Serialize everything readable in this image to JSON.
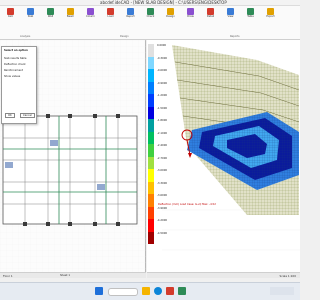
{
  "window": {
    "title": "abcdef.ideCAD - [NEW SLAB DESIGN] - C:\\USERS\\ENG\\DESKTOP"
  },
  "ribbon": {
    "buttons": [
      {
        "label": "Calc"
      },
      {
        "label": "Slab"
      },
      {
        "label": "Wall"
      },
      {
        "label": "Beam"
      },
      {
        "label": "Column"
      },
      {
        "label": "Load"
      },
      {
        "label": "Report"
      },
      {
        "label": "Check"
      },
      {
        "label": "Design"
      },
      {
        "label": "Draw"
      },
      {
        "label": "Detail"
      },
      {
        "label": "View"
      },
      {
        "label": "Table"
      },
      {
        "label": "Export"
      }
    ],
    "groups": [
      "Analysis",
      "Design",
      "Reports"
    ],
    "accent": "#d33b2c"
  },
  "dialog": {
    "title": "Select an option",
    "lines": [
      "Slab results table",
      "Deflection check",
      "Reinforcement",
      "Show values",
      "OK",
      "Cancel"
    ]
  },
  "legend": {
    "ticks": [
      "0.0000",
      "-0.3000",
      "-0.6000",
      "-0.9000",
      "-1.2000",
      "-1.5000",
      "-1.8000",
      "-2.1000",
      "-2.4000",
      "-2.7000",
      "-3.0000",
      "-3.3000",
      "-3.6000",
      "-3.9000",
      "-4.2000",
      "-4.5000"
    ],
    "colors": [
      "#e0e0e0",
      "#7fd7ff",
      "#00b5ff",
      "#007fff",
      "#003fff",
      "#0000e0",
      "#00a0a0",
      "#00c060",
      "#40d040",
      "#a0e040",
      "#ffff00",
      "#ffc000",
      "#ff8000",
      "#ff4000",
      "#ff0000",
      "#a00000"
    ]
  },
  "caption": "Deflection (mm)  Load Case: G+Q  Max: -4.52",
  "status": {
    "left": "Floor 1",
    "right": "Scale 1:100"
  },
  "sheet": "Sheet 1"
}
